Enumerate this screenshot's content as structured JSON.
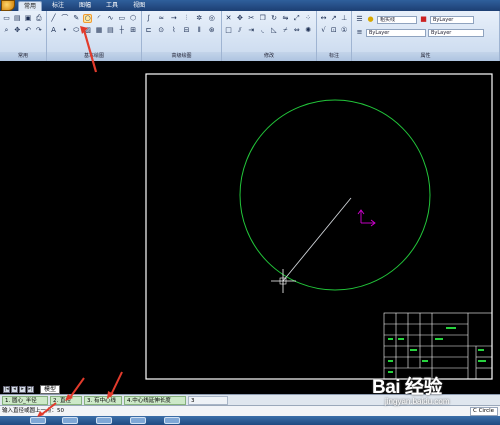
{
  "ribbon_tabs": [
    "常用",
    "标注",
    "图幅",
    "工具",
    "视图"
  ],
  "panels": {
    "normal": "常用",
    "draw": "基本绘图",
    "advanced": "高级绘图",
    "modify": "修改",
    "dimension": "标注",
    "properties": "属性"
  },
  "properties": {
    "linetype_top": "粗实线",
    "bylayer_top": "ByLayer",
    "bylayer_mid": "ByLayer",
    "bylayer_right": "ByLayer"
  },
  "layout": {
    "model_tab": "模型"
  },
  "command_tabs": [
    "1. 圆心_半径",
    "2. 直径",
    "3. 有中心线",
    "4.中心线延伸长度",
    "3"
  ],
  "command_line": {
    "prompt": "输入直径或圆上一点：50",
    "active_command": "C Circle"
  },
  "watermark": {
    "logo": "Bai 经验",
    "url": "jingyan.baidu.com"
  },
  "colors": {
    "canvas_bg": "#000000",
    "circle": "#22c53a",
    "rubber_band": "#cfd3d8",
    "ucs": "#d400d4",
    "frame": "#ffffff",
    "annotation_arrow": "#e23b2c",
    "title_block_green": "#27d23e"
  },
  "icons": [
    "app-menu-icon",
    "line-icon",
    "circle-icon",
    "arc-icon",
    "rectangle-icon",
    "hatch-icon",
    "text-icon",
    "move-icon",
    "copy-icon",
    "trim-icon",
    "layer-icon",
    "lightbulb-icon",
    "color-swatch-icon",
    "crosshair-cursor-icon",
    "ucs-icon"
  ]
}
